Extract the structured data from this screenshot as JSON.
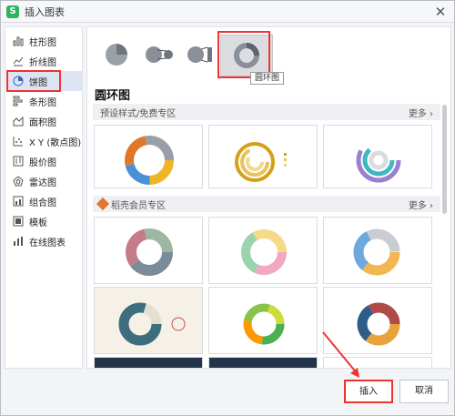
{
  "window": {
    "title": "插入图表",
    "logo": "S",
    "close": "✕"
  },
  "sidebar": {
    "items": [
      {
        "label": "柱形图",
        "icon": "column-chart-icon"
      },
      {
        "label": "折线图",
        "icon": "line-chart-icon"
      },
      {
        "label": "饼图",
        "icon": "pie-chart-icon"
      },
      {
        "label": "条形图",
        "icon": "bar-chart-icon"
      },
      {
        "label": "面积图",
        "icon": "area-chart-icon"
      },
      {
        "label": "X Y (散点图)",
        "icon": "scatter-chart-icon"
      },
      {
        "label": "股价图",
        "icon": "stock-chart-icon"
      },
      {
        "label": "雷达图",
        "icon": "radar-chart-icon"
      },
      {
        "label": "组合图",
        "icon": "combo-chart-icon"
      },
      {
        "label": "模板",
        "icon": "template-icon"
      },
      {
        "label": "在线图表",
        "icon": "online-chart-icon"
      }
    ],
    "active_index": 2
  },
  "subtypes": {
    "tooltip": "圆环图"
  },
  "heading": "圆环图",
  "sections": {
    "preset": {
      "label": "预设样式/免费专区",
      "more": "更多"
    },
    "member": {
      "label": "稻壳会员专区",
      "more": "更多"
    }
  },
  "buttons": {
    "insert": "插入",
    "cancel": "取消"
  },
  "colors": {
    "accent_red": "#e33333",
    "active_bg": "#dde4f3",
    "logo_green": "#2db55d"
  }
}
